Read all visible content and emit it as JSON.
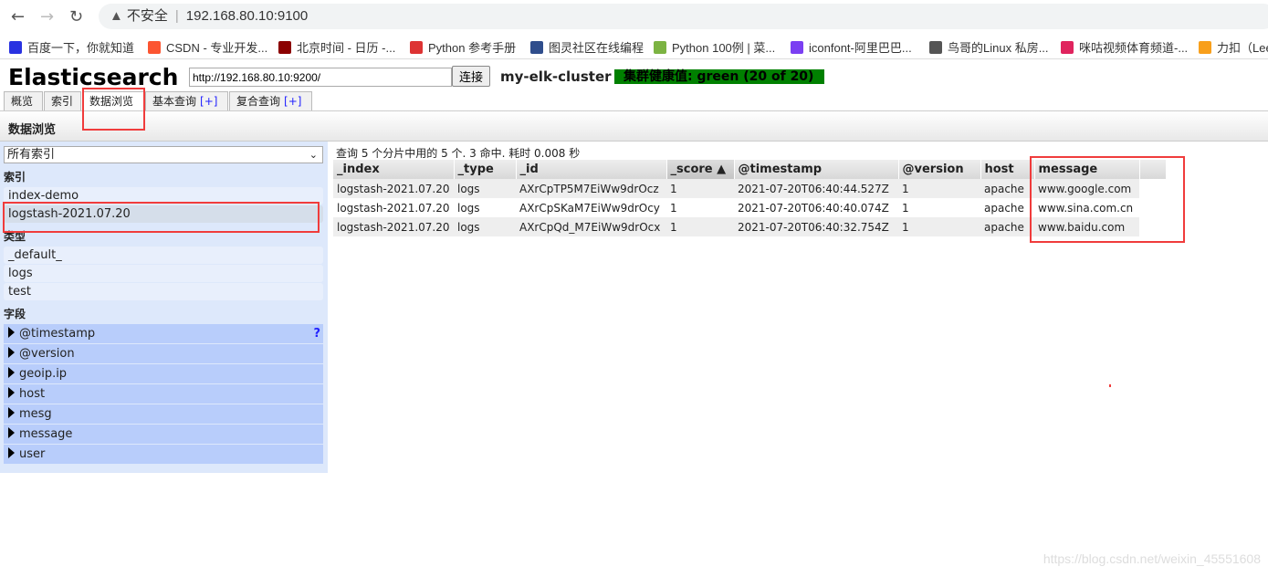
{
  "browser": {
    "security": "不安全",
    "url": "192.168.80.10:9100",
    "bookmarks": [
      {
        "label": "百度一下，你就知道",
        "color": "#2932e1"
      },
      {
        "label": "CSDN - 专业开发...",
        "color": "#fc5531"
      },
      {
        "label": "北京时间 - 日历 -...",
        "color": "#8b0000"
      },
      {
        "label": "Python 参考手册",
        "color": "#d33"
      },
      {
        "label": "图灵社区在线编程",
        "color": "#2f4d8c"
      },
      {
        "label": "Python 100例 | 菜...",
        "color": "#7cb342"
      },
      {
        "label": "iconfont-阿里巴巴...",
        "color": "#7b3ff2"
      },
      {
        "label": "鸟哥的Linux 私房...",
        "color": "#555"
      },
      {
        "label": "咪咕视频体育频道-...",
        "color": "#e0245e"
      },
      {
        "label": "力扣（Lee",
        "color": "#f89f1b"
      }
    ]
  },
  "header": {
    "title": "Elasticsearch",
    "connect_url": "http://192.168.80.10:9200/",
    "connect_label": "连接",
    "cluster_name": "my-elk-cluster",
    "health": "集群健康值: green (20 of 20)",
    "health_color": "#008000"
  },
  "tabs": [
    {
      "label": "概览"
    },
    {
      "label": "索引"
    },
    {
      "label": "数据浏览",
      "active": true
    },
    {
      "label": "基本查询",
      "plus": "[+]"
    },
    {
      "label": "复合查询",
      "plus": "[+]"
    }
  ],
  "page_title": "数据浏览",
  "sidebar": {
    "select_value": "所有索引",
    "indices_label": "索引",
    "indices": [
      "index-demo",
      "logstash-2021.07.20"
    ],
    "types_label": "类型",
    "types": [
      "_default_",
      "logs",
      "test"
    ],
    "fields_label": "字段",
    "fields": [
      "@timestamp",
      "@version",
      "geoip.ip",
      "host",
      "mesg",
      "message",
      "user"
    ],
    "help": "?"
  },
  "results": {
    "summary": "查询 5 个分片中用的 5 个. 3 命中. 耗时 0.008 秒",
    "columns": [
      "_index",
      "_type",
      "_id",
      "_score ▲",
      "@timestamp",
      "@version",
      "host",
      "message",
      ""
    ],
    "rows": [
      [
        "logstash-2021.07.20",
        "logs",
        "AXrCpTP5M7EiWw9drOcz",
        "1",
        "2021-07-20T06:40:44.527Z",
        "1",
        "apache",
        "www.google.com"
      ],
      [
        "logstash-2021.07.20",
        "logs",
        "AXrCpSKaM7EiWw9drOcy",
        "1",
        "2021-07-20T06:40:40.074Z",
        "1",
        "apache",
        "www.sina.com.cn"
      ],
      [
        "logstash-2021.07.20",
        "logs",
        "AXrCpQd_M7EiWw9drOcx",
        "1",
        "2021-07-20T06:40:32.754Z",
        "1",
        "apache",
        "www.baidu.com"
      ]
    ]
  },
  "watermark": "https://blog.csdn.net/weixin_45551608"
}
